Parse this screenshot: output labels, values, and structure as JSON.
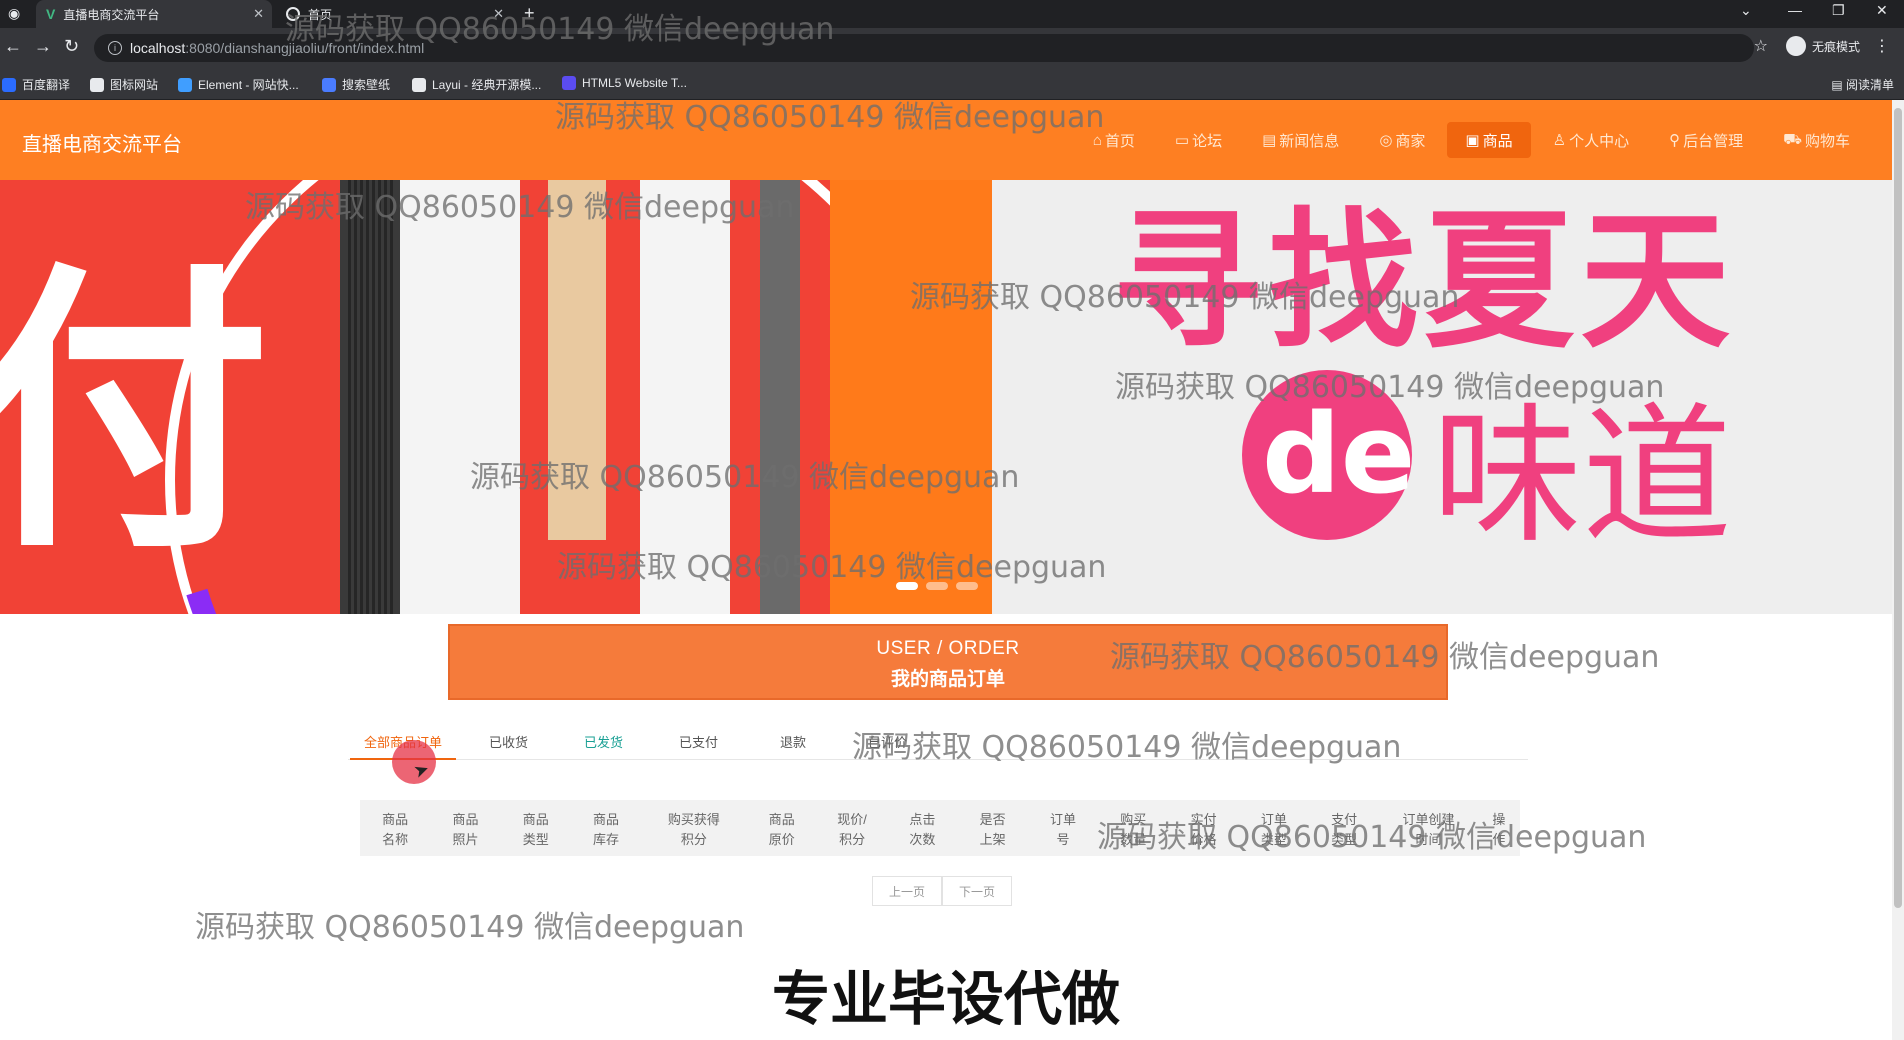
{
  "browser": {
    "tabs": [
      {
        "title": "直播电商交流平台",
        "icon": "vue-logo-icon",
        "active": false
      },
      {
        "title": "首页",
        "icon": "globe-icon",
        "active": true
      }
    ],
    "url_host": "localhost",
    "url_path": ":8080/dianshangjiaoliu/front/index.html",
    "profile_label": "无痕模式",
    "bookmarks": [
      {
        "label": "百度翻译",
        "color": "#2b6cff"
      },
      {
        "label": "图标网站",
        "color": "#e8eaed"
      },
      {
        "label": "Element - 网站快...",
        "color": "#409eff"
      },
      {
        "label": "搜索壁纸",
        "color": "#4a7cff"
      },
      {
        "label": "Layui - 经典开源模...",
        "color": "#e8eaed"
      },
      {
        "label": "HTML5 Website T...",
        "color": "#5b4cf0"
      }
    ],
    "reading_list": "阅读清单"
  },
  "site": {
    "title": "直播电商交流平台",
    "accent_color": "#fe7f22",
    "nav": [
      {
        "label": "首页",
        "icon": "home-icon",
        "glyph": "⌂",
        "active": false
      },
      {
        "label": "论坛",
        "icon": "forum-icon",
        "glyph": "▭",
        "active": false
      },
      {
        "label": "新闻信息",
        "icon": "news-icon",
        "glyph": "▤",
        "active": false
      },
      {
        "label": "商家",
        "icon": "shop-icon",
        "glyph": "◎",
        "active": false
      },
      {
        "label": "商品",
        "icon": "goods-icon",
        "glyph": "▣",
        "active": true
      },
      {
        "label": "个人中心",
        "icon": "user-icon",
        "glyph": "♙",
        "active": false
      },
      {
        "label": "后台管理",
        "icon": "link-icon",
        "glyph": "⚲",
        "active": false
      },
      {
        "label": "购物车",
        "icon": "cart-icon",
        "glyph": "⛟",
        "active": false
      }
    ]
  },
  "banner": {
    "left_text": "付",
    "right_text_top": "寻找夏天",
    "right_text_de": "de",
    "right_text_bottom": "味道",
    "slide_count": 3,
    "active_slide": 0
  },
  "order_section": {
    "title_en": "USER / ORDER",
    "title_cn": "我的商品订单",
    "tabs": [
      {
        "label": "全部商品订单",
        "state": "active"
      },
      {
        "label": "已收货",
        "state": "normal"
      },
      {
        "label": "已发货",
        "state": "green"
      },
      {
        "label": "已支付",
        "state": "normal"
      },
      {
        "label": "退款",
        "state": "normal"
      },
      {
        "label": "已评价",
        "state": "normal"
      }
    ],
    "columns": [
      "商品\n名称",
      "商品\n照片",
      "商品\n类型",
      "商品\n库存",
      "购买获得\n积分",
      "商品\n原价",
      "现价/\n积分",
      "点击\n次数",
      "是否\n上架",
      "订单\n号",
      "购买\n数量",
      "实付\n价格",
      "订单\n类型",
      "支付\n类型",
      "订单创建\n时间",
      "操\n作"
    ],
    "pager": {
      "prev": "上一页",
      "next": "下一页"
    }
  },
  "footer_caption": "专业毕设代做",
  "watermark_text": "源码获取 QQ86050149 微信deepguan"
}
